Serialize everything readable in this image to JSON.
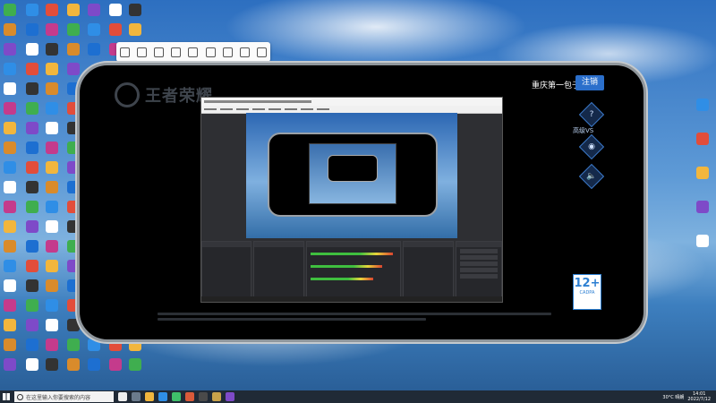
{
  "game": {
    "logo_text": "王者荣耀",
    "username": "重庆第一包子",
    "logout_label": "注销",
    "side_buttons": [
      "?",
      "高级VS",
      "🔈"
    ],
    "age_rating": "12+",
    "age_rating_sub": "CADPA",
    "age_rating_label": "适龄提示"
  },
  "taskbar": {
    "search_placeholder": "在这里输入你要搜索的内容",
    "weather": "30°C 晴朗",
    "time": "14:01",
    "date": "2022/7/12"
  },
  "colors": {
    "accent": "#2b6fcb",
    "phone_bg": "#000000",
    "taskbar": "#202a36"
  }
}
